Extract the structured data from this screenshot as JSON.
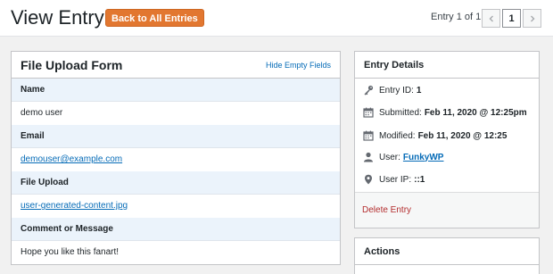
{
  "header": {
    "title": "View Entry",
    "back_button": "Back to All Entries",
    "entry_count": "Entry 1 of 1",
    "current_page": "1"
  },
  "form": {
    "title": "File Upload Form",
    "hide_empty_link": "Hide Empty Fields",
    "fields": [
      {
        "label": "Name",
        "value": "demo user"
      },
      {
        "label": "Email",
        "value": "demouser@example.com"
      },
      {
        "label": "File Upload",
        "value": "user-generated-content.jpg"
      },
      {
        "label": "Comment or Message",
        "value": "Hope you like this fanart!"
      }
    ]
  },
  "details": {
    "title": "Entry Details",
    "entry_id_label": "Entry ID:",
    "entry_id": "1",
    "submitted_label": "Submitted:",
    "submitted": "Feb 11, 2020 @ 12:25pm",
    "modified_label": "Modified:",
    "modified": "Feb 11, 2020 @ 12:25",
    "user_label": "User:",
    "user": "FunkyWP",
    "user_ip_label": "User IP:",
    "user_ip": "::1",
    "delete_link": "Delete Entry"
  },
  "actions": {
    "title": "Actions"
  },
  "colors": {
    "accent": "#e27730",
    "link": "#056bb7",
    "delete": "#b32d2e",
    "label_bg": "#ebf3fb"
  },
  "icons": {
    "prev": "chevron-left-icon",
    "next": "chevron-right-icon",
    "entry_id": "key-icon",
    "submitted": "calendar-icon",
    "modified": "calendar-icon",
    "user": "user-icon",
    "user_ip": "location-pin-icon"
  }
}
